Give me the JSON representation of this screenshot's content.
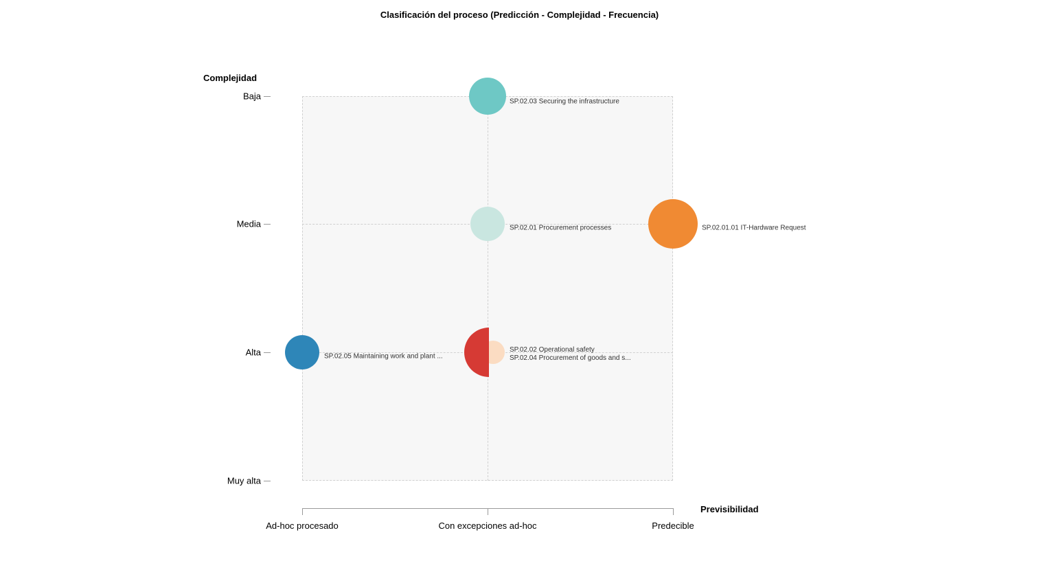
{
  "chart_data": {
    "type": "scatter",
    "title": "Clasificación del proceso (Predicción - Complejidad - Frecuencia)",
    "xlabel": "Previsibilidad",
    "ylabel": "Complejidad",
    "x_categories": [
      "Ad-hoc procesado",
      "Con excepciones ad-hoc",
      "Predecible"
    ],
    "y_categories": [
      "Baja",
      "Media",
      "Alta",
      "Muy alta"
    ],
    "series": [
      {
        "name": "SP.02.03 Securing the infrastructure",
        "x": "Con excepciones ad-hoc",
        "y": "Baja",
        "size": 2,
        "color": "#6ec8c5"
      },
      {
        "name": "SP.02.01 Procurement processes",
        "x": "Con excepciones ad-hoc",
        "y": "Media",
        "size": 2,
        "color": "#c9e6e0"
      },
      {
        "name": "SP.02.01.01 IT-Hardware Request",
        "x": "Predecible",
        "y": "Media",
        "size": 3,
        "color": "#f08a33"
      },
      {
        "name": "SP.02.05 Maintaining work and plant ...",
        "x": "Ad-hoc procesado",
        "y": "Alta",
        "size": 2,
        "color": "#2e86b8"
      },
      {
        "name": "SP.02.02 Operational safety",
        "x": "Con excepciones ad-hoc",
        "y": "Alta",
        "size": 3,
        "color": "#d63a34"
      },
      {
        "name": "SP.02.04 Procurement of goods and s...",
        "x": "Con excepciones ad-hoc",
        "y": "Alta",
        "size": 1,
        "color": "#fbdcc2"
      }
    ]
  },
  "labels": {
    "title": "Clasificación del proceso (Predicción - Complejidad - Frecuencia)",
    "y_axis": "Complejidad",
    "x_axis": "Previsibilidad",
    "y_ticks": {
      "0": "Baja",
      "1": "Media",
      "2": "Alta",
      "3": "Muy alta"
    },
    "x_ticks": {
      "0": "Ad-hoc procesado",
      "1": "Con excepciones ad-hoc",
      "2": "Predecible"
    },
    "p0": "SP.02.03 Securing the infrastructure",
    "p1": "SP.02.01 Procurement processes",
    "p2": "SP.02.01.01 IT-Hardware Request",
    "p3": "SP.02.05 Maintaining work and plant ...",
    "p4a": "SP.02.02 Operational safety",
    "p4b": "SP.02.04 Procurement of goods and s..."
  },
  "colors": {
    "teal": "#6ec8c5",
    "paleteal": "#c9e6e0",
    "orange": "#f08a33",
    "blue": "#2e86b8",
    "red": "#d63a34",
    "peach": "#fbdcc2"
  }
}
